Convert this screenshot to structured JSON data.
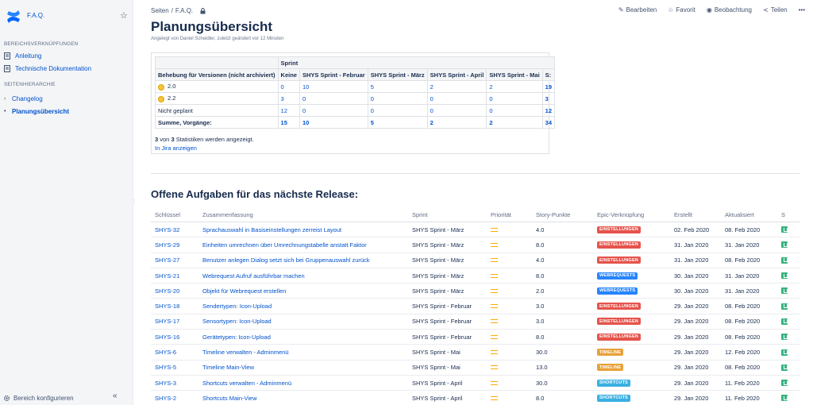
{
  "sidebar": {
    "space_name": "F.A.Q.",
    "section_links_title": "BEREICHSVERKNÜPFUNGEN",
    "links": [
      {
        "label": "Anleitung",
        "icon": "document-icon"
      },
      {
        "label": "Technische Dokumentation",
        "icon": "document-icon"
      }
    ],
    "section_tree_title": "SEITENHIERARCHIE",
    "tree": [
      {
        "label": "Changelog",
        "active": false
      },
      {
        "label": "Planungsübersicht",
        "active": true
      }
    ],
    "footer_label": "Bereich konfigurieren",
    "collapse_glyph": "«"
  },
  "header": {
    "breadcrumb": [
      "Seiten",
      "/",
      "F.A.Q."
    ],
    "actions": [
      {
        "label": "Bearbeiten",
        "icon": "pencil-icon"
      },
      {
        "label": "Favorit",
        "icon": "star-icon"
      },
      {
        "label": "Beobachtung",
        "icon": "eye-icon"
      },
      {
        "label": "Teilen",
        "icon": "share-icon"
      },
      {
        "label": "•••",
        "icon": "more-icon"
      }
    ]
  },
  "page": {
    "title": "Planungsübersicht",
    "byline": "Angelegt von Daniel Scheidler, zuletzt geändert vor 12 Minuten"
  },
  "stats": {
    "group_header": "Sprint",
    "row_header": "Behebung für Versionen (nicht archiviert)",
    "columns": [
      "Keine",
      "SHYS Sprint - Februar",
      "SHYS Sprint - März",
      "SHYS Sprint - April",
      "SHYS Sprint - Mai",
      "S:"
    ],
    "rows": [
      {
        "label": "2.0",
        "version": true,
        "values": [
          "0",
          "10",
          "5",
          "2",
          "2",
          "19"
        ]
      },
      {
        "label": "2.2",
        "version": true,
        "values": [
          "3",
          "0",
          "0",
          "0",
          "0",
          "3"
        ]
      },
      {
        "label": "Nicht geplant",
        "version": false,
        "values": [
          "12",
          "0",
          "0",
          "0",
          "0",
          "12"
        ]
      }
    ],
    "sum_label": "Summe, Vorgänge:",
    "sum_values": [
      "15",
      "10",
      "5",
      "2",
      "2",
      "34"
    ],
    "note_count": "3",
    "note_mid": " von ",
    "note_total": "3",
    "note_tail": " Statistiken werden angezeigt.",
    "jira_link": "In Jira anzeigen"
  },
  "issues": {
    "title": "Offene Aufgaben für das nächste Release:",
    "columns": [
      "Schlüssel",
      "Zusammenfassung",
      "Sprint",
      "Priorität",
      "Story-Punkte",
      "Epic-Verknüpfung",
      "Erstellt",
      "Aktualisiert",
      "S"
    ],
    "epic_colors": {
      "EINSTELLUNGEN": "#e5534b",
      "WEBREQUESTS": "#2684ff",
      "TIMELINE": "#e8a13a",
      "SHORTCUTS": "#3ab0e2"
    },
    "rows": [
      {
        "key": "SHYS-32",
        "summary": "Sprachauswahl in Basiseinstellungen zerreist Layout",
        "sprint": "SHYS Sprint - März",
        "points": "4.0",
        "epic": "EINSTELLUNGEN",
        "created": "02. Feb 2020",
        "updated": "08. Feb 2020"
      },
      {
        "key": "SHYS-29",
        "summary": "Einheiten umrechnen über Umrechnungstabelle anstatt Faktor",
        "sprint": "SHYS Sprint - März",
        "points": "8.0",
        "epic": "EINSTELLUNGEN",
        "created": "31. Jan 2020",
        "updated": "31. Jan 2020"
      },
      {
        "key": "SHYS-27",
        "summary": "Benutzer anlegen Dialog setzt sich bei Gruppenauswahl zurück",
        "sprint": "SHYS Sprint - März",
        "points": "4.0",
        "epic": "EINSTELLUNGEN",
        "created": "31. Jan 2020",
        "updated": "08. Feb 2020"
      },
      {
        "key": "SHYS-21",
        "summary": "Webrequest Aufruf ausführbar machen",
        "sprint": "SHYS Sprint - März",
        "points": "8.0",
        "epic": "WEBREQUESTS",
        "created": "30. Jan 2020",
        "updated": "31. Jan 2020"
      },
      {
        "key": "SHYS-20",
        "summary": "Objekt für Webrequest erstellen",
        "sprint": "SHYS Sprint - März",
        "points": "2.0",
        "epic": "WEBREQUESTS",
        "created": "30. Jan 2020",
        "updated": "31. Jan 2020"
      },
      {
        "key": "SHYS-18",
        "summary": "Sendertypen: Icon-Upload",
        "sprint": "SHYS Sprint - Februar",
        "points": "3.0",
        "epic": "EINSTELLUNGEN",
        "created": "29. Jan 2020",
        "updated": "08. Feb 2020"
      },
      {
        "key": "SHYS-17",
        "summary": "Sensortypen: Icon-Upload",
        "sprint": "SHYS Sprint - Februar",
        "points": "3.0",
        "epic": "EINSTELLUNGEN",
        "created": "29. Jan 2020",
        "updated": "08. Feb 2020"
      },
      {
        "key": "SHYS-16",
        "summary": "Gerätetypen: Icon-Upload",
        "sprint": "SHYS Sprint - Februar",
        "points": "8.0",
        "epic": "EINSTELLUNGEN",
        "created": "29. Jan 2020",
        "updated": "08. Feb 2020"
      },
      {
        "key": "SHYS-6",
        "summary": "Timeline verwalten - Adminmenü",
        "sprint": "SHYS Sprint - Mai",
        "points": "30.0",
        "epic": "TIMELINE",
        "created": "29. Jan 2020",
        "updated": "12. Feb 2020"
      },
      {
        "key": "SHYS-5",
        "summary": "Timeline Main-View",
        "sprint": "SHYS Sprint - Mai",
        "points": "13.0",
        "epic": "TIMELINE",
        "created": "29. Jan 2020",
        "updated": "08. Feb 2020"
      },
      {
        "key": "SHYS-3",
        "summary": "Shortcuts verwalten - Adminmenü",
        "sprint": "SHYS Sprint - April",
        "points": "30.0",
        "epic": "SHORTCUTS",
        "created": "29. Jan 2020",
        "updated": "11. Feb 2020"
      },
      {
        "key": "SHYS-2",
        "summary": "Shortcuts Main-View",
        "sprint": "SHYS Sprint - April",
        "points": "8.0",
        "epic": "SHORTCUTS",
        "created": "29. Jan 2020",
        "updated": "11. Feb 2020"
      }
    ]
  }
}
